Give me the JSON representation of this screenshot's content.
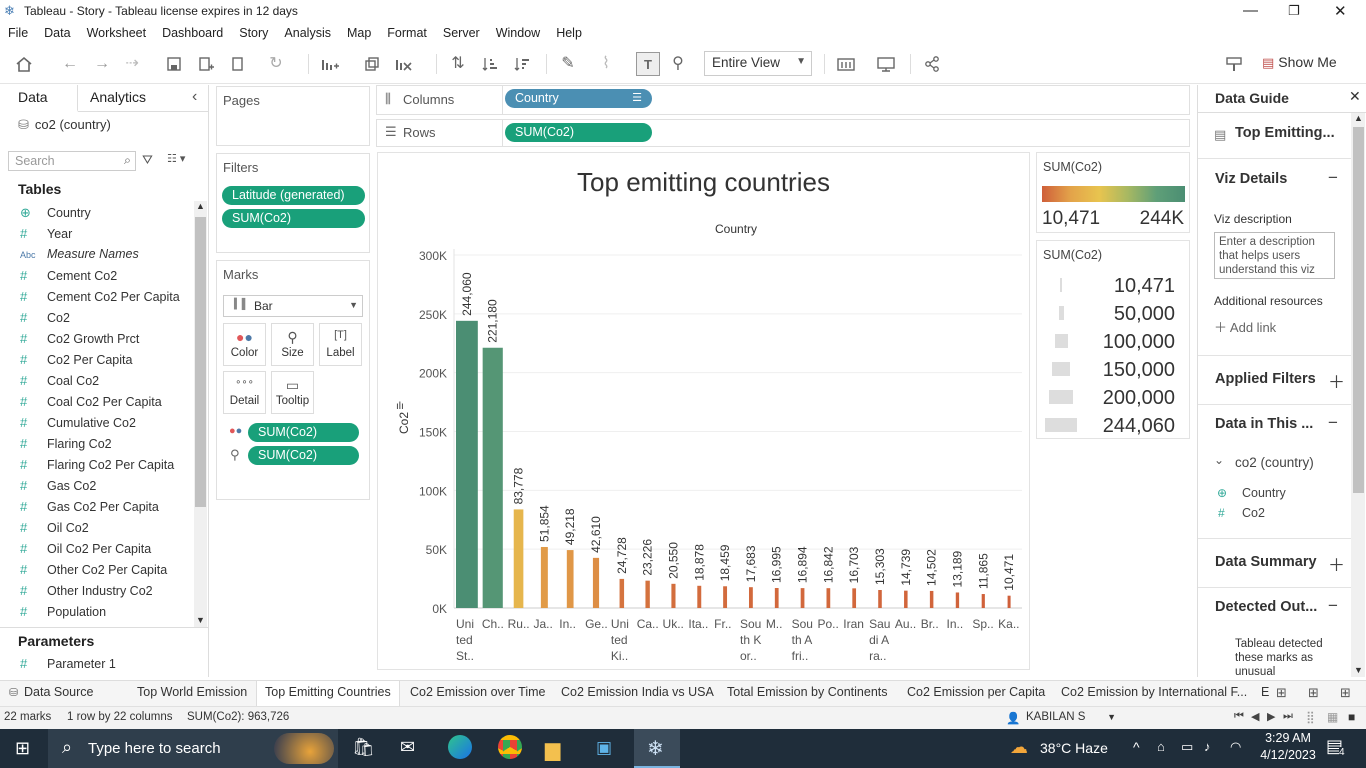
{
  "window": {
    "title": "Tableau - Story - Tableau license expires in 12 days"
  },
  "menu": [
    "File",
    "Data",
    "Worksheet",
    "Dashboard",
    "Story",
    "Analysis",
    "Map",
    "Format",
    "Server",
    "Window",
    "Help"
  ],
  "toolbar": {
    "view_mode": "Entire View",
    "show_me": "Show Me"
  },
  "left_panel": {
    "tab_data": "Data",
    "tab_analytics": "Analytics",
    "datasource": "co2 (country)",
    "search_placeholder": "Search",
    "tables_title": "Tables",
    "fields": [
      {
        "icon": "globe",
        "label": "Country"
      },
      {
        "icon": "#",
        "label": "Year"
      },
      {
        "icon": "Abc",
        "label": "Measure Names"
      },
      {
        "icon": "#",
        "label": "Cement Co2"
      },
      {
        "icon": "#",
        "label": "Cement Co2 Per Capita"
      },
      {
        "icon": "#",
        "label": "Co2"
      },
      {
        "icon": "#",
        "label": "Co2 Growth Prct"
      },
      {
        "icon": "#",
        "label": "Co2 Per Capita"
      },
      {
        "icon": "#",
        "label": "Coal Co2"
      },
      {
        "icon": "#",
        "label": "Coal Co2 Per Capita"
      },
      {
        "icon": "#",
        "label": "Cumulative Co2"
      },
      {
        "icon": "#",
        "label": "Flaring Co2"
      },
      {
        "icon": "#",
        "label": "Flaring Co2 Per Capita"
      },
      {
        "icon": "#",
        "label": "Gas Co2"
      },
      {
        "icon": "#",
        "label": "Gas Co2 Per Capita"
      },
      {
        "icon": "#",
        "label": "Oil Co2"
      },
      {
        "icon": "#",
        "label": "Oil Co2 Per Capita"
      },
      {
        "icon": "#",
        "label": "Other Co2 Per Capita"
      },
      {
        "icon": "#",
        "label": "Other Industry Co2"
      },
      {
        "icon": "#",
        "label": "Population"
      }
    ],
    "parameters_title": "Parameters",
    "parameters": [
      {
        "icon": "#",
        "label": "Parameter 1"
      }
    ]
  },
  "shelves": {
    "pages": "Pages",
    "filters": "Filters",
    "filter_pills": [
      "Latitude (generated)",
      "SUM(Co2)"
    ],
    "marks": "Marks",
    "mark_type": "Bar",
    "mark_buttons": [
      "Color",
      "Size",
      "Label",
      "Detail",
      "Tooltip"
    ],
    "mark_pills": [
      "SUM(Co2)",
      "SUM(Co2)"
    ],
    "columns": "Columns",
    "columns_pill": "Country",
    "rows": "Rows",
    "rows_pill": "SUM(Co2)"
  },
  "chart_data": {
    "type": "bar",
    "title": "Top emitting countries",
    "header": "Country",
    "ylabel": "Co2",
    "ylim": [
      0,
      300000
    ],
    "yticks": [
      "0K",
      "50K",
      "100K",
      "150K",
      "200K",
      "250K",
      "300K"
    ],
    "categories": [
      [
        "Uni",
        "ted",
        "St.."
      ],
      [
        "Ch.."
      ],
      [
        "Ru.."
      ],
      [
        "Ja.."
      ],
      [
        "In.."
      ],
      [
        "Ge.."
      ],
      [
        "Uni",
        "ted",
        "Ki.."
      ],
      [
        "Ca.."
      ],
      [
        "Uk.."
      ],
      [
        "Ita.."
      ],
      [
        "Fr.."
      ],
      [
        "Sou",
        "th K",
        "or.."
      ],
      [
        "M.."
      ],
      [
        "Sou",
        "th A",
        "fri.."
      ],
      [
        "Po.."
      ],
      [
        "Iran"
      ],
      [
        "Sau",
        "di A",
        "ra.."
      ],
      [
        "Au.."
      ],
      [
        "Br.."
      ],
      [
        "In.."
      ],
      [
        "Sp.."
      ],
      [
        "Ka.."
      ]
    ],
    "values": [
      244060,
      221180,
      83778,
      51854,
      49218,
      42610,
      24728,
      23226,
      20550,
      18878,
      18459,
      17683,
      16995,
      16894,
      16842,
      16703,
      15303,
      14739,
      14502,
      13189,
      11865,
      10471
    ],
    "labels": [
      "244,060",
      "221,180",
      "83,778",
      "51,854",
      "49,218",
      "42,610",
      "24,728",
      "23,226",
      "20,550",
      "18,878",
      "18,459",
      "17,683",
      "16,995",
      "16,894",
      "16,842",
      "16,703",
      "15,303",
      "14,739",
      "14,502",
      "13,189",
      "11,865",
      "10,471"
    ],
    "color_min": 10471,
    "color_max": 244060
  },
  "color_legend": {
    "title": "SUM(Co2)",
    "min_label": "10,471",
    "max_label": "244K"
  },
  "size_legend": {
    "title": "SUM(Co2)",
    "items": [
      "10,471",
      "50,000",
      "100,000",
      "150,000",
      "200,000",
      "244,060"
    ]
  },
  "data_guide": {
    "title": "Data Guide",
    "sheet": "Top Emitting...",
    "viz_details": "Viz Details",
    "viz_description_label": "Viz description",
    "viz_description_placeholder": "Enter a description that helps users understand this viz",
    "additional_resources": "Additional resources",
    "add_link": "Add link",
    "applied_filters": "Applied Filters",
    "data_in_this": "Data in This ...",
    "datasource": "co2 (country)",
    "fields": [
      "Country",
      "Co2"
    ],
    "data_summary": "Data Summary",
    "detected_outliers": "Detected Out...",
    "outlier_text": "Tableau detected these marks as unusual"
  },
  "sheet_tabs": [
    "Data Source",
    "Top World Emission",
    "Top Emitting Countries",
    "Co2 Emission over Time",
    "Co2 Emission India vs USA",
    "Total Emission by Continents",
    "Co2 Emission per Capita",
    "Co2 Emission by International F...",
    "E"
  ],
  "active_tab": "Top Emitting Countries",
  "status": {
    "marks": "22 marks",
    "dims": "1 row by 22 columns",
    "sum": "SUM(Co2): 963,726",
    "user": "KABILAN S"
  },
  "taskbar": {
    "search": "Type here to search",
    "weather": "38°C  Haze",
    "time": "3:29 AM",
    "date": "4/12/2023",
    "notifications": "4"
  }
}
